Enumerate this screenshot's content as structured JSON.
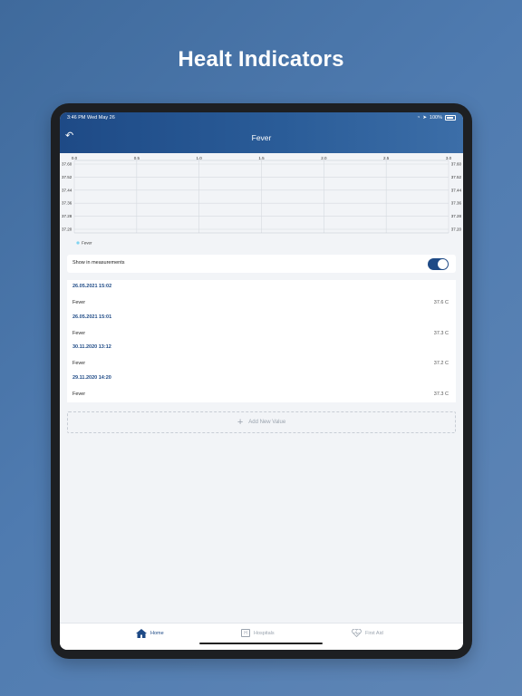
{
  "headline": "Healt Indicators",
  "status_bar": {
    "time": "3:46 PM  Wed May 26",
    "battery_percent": "100%"
  },
  "header": {
    "title": "Fever",
    "back_icon": "back-arrow-icon"
  },
  "chart_data": {
    "type": "line",
    "x_ticks": [
      "0.0",
      "0.5",
      "1.0",
      "1.5",
      "2.0",
      "2.5",
      "3.0"
    ],
    "xlim": [
      0.0,
      3.0
    ],
    "y_ticks": [
      "37.60",
      "37.52",
      "37.44",
      "37.36",
      "37.28",
      "37.20"
    ],
    "ylim": [
      37.2,
      37.6
    ],
    "grid": true,
    "series": [
      {
        "name": "Fever",
        "values": []
      }
    ],
    "legend": "bottom-left",
    "legend_color": "#7fd3f0"
  },
  "toggle": {
    "label": "Show in measurements",
    "checked": true
  },
  "entries": [
    {
      "date": "26.05.2021 15:02",
      "name": "Fever",
      "value": "37.6 C"
    },
    {
      "date": "26.05.2021 15:01",
      "name": "Fever",
      "value": "37.3 C"
    },
    {
      "date": "30.11.2020 13:12",
      "name": "Fever",
      "value": "37.2 C"
    },
    {
      "date": "29.11.2020 14:20",
      "name": "Fever",
      "value": "37.3 C"
    }
  ],
  "add_button": {
    "label": "Add New Value"
  },
  "tabs": [
    {
      "label": "Home",
      "icon": "home-icon",
      "active": true
    },
    {
      "label": "Hospitals",
      "icon": "hospital-icon",
      "active": false
    },
    {
      "label": "First Aid",
      "icon": "first-aid-icon",
      "active": false
    }
  ],
  "colors": {
    "accent": "#1e4a86",
    "background_gradient_start": "#3f6a9c"
  }
}
